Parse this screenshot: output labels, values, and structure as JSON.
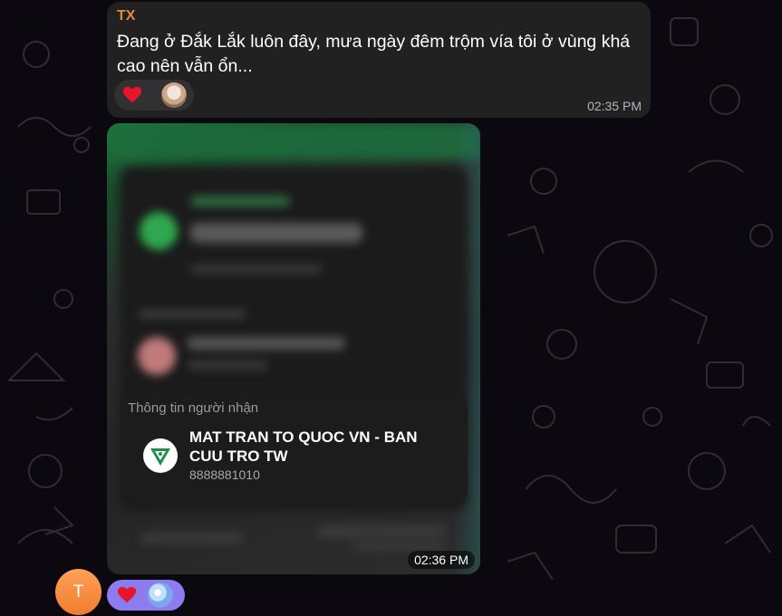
{
  "message1": {
    "sender": "TX",
    "text": "Đang ở Đắk Lắk luôn đây, mưa ngày đêm trộm vía tôi ở vùng khá cao nên vẫn ổn...",
    "time": "02:35 PM",
    "reactions": [
      {
        "emoji": "heart"
      },
      {
        "user": "avatar"
      }
    ]
  },
  "message2": {
    "recipient_label": "Thông tin người nhận",
    "recipient_name": "MAT TRAN TO QUOC VN - BAN CUU TRO TW",
    "recipient_account": "8888881010",
    "time": "02:36 PM",
    "reactions": [
      {
        "emoji": "heart"
      },
      {
        "user": "avatar"
      }
    ]
  },
  "user_avatar_initial": "T",
  "colors": {
    "sender": "#e8873c",
    "bubble": "#212121",
    "reaction_active": "#8b7cf0",
    "avatar": "#f58a3c"
  },
  "icons": {
    "heart": "heart-icon",
    "logo": "mttq-logo-icon"
  }
}
